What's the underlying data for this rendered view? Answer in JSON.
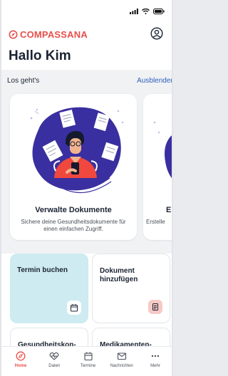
{
  "app": {
    "brand": "COMPASSANA",
    "brand_color": "#e84f4a",
    "greeting": "Hallo Kim"
  },
  "intro": {
    "title": "Los geht's",
    "action": "Ausblenden",
    "cards": [
      {
        "title": "Verwalte Dokumente",
        "description": "Sichere deine Gesundheitsdokumente für einen einfachen Zugriff."
      },
      {
        "title": "Er",
        "description": "Erstelle"
      }
    ]
  },
  "tiles": [
    {
      "title": "Termin buchen",
      "icon": "calendar-icon"
    },
    {
      "title": "Dokument hinzufügen",
      "icon": "document-icon"
    },
    {
      "title": "Gesundheitskon-",
      "icon": ""
    },
    {
      "title": "Medikamenten-",
      "icon": ""
    }
  ],
  "tabs": [
    {
      "label": "Home",
      "icon": "compass-icon",
      "active": true
    },
    {
      "label": "Daten",
      "icon": "heartbeat-icon",
      "active": false
    },
    {
      "label": "Termine",
      "icon": "calendar-icon",
      "active": false
    },
    {
      "label": "Nachrichten",
      "icon": "mail-icon",
      "active": false
    },
    {
      "label": "Mehr",
      "icon": "more-icon",
      "active": false
    }
  ]
}
